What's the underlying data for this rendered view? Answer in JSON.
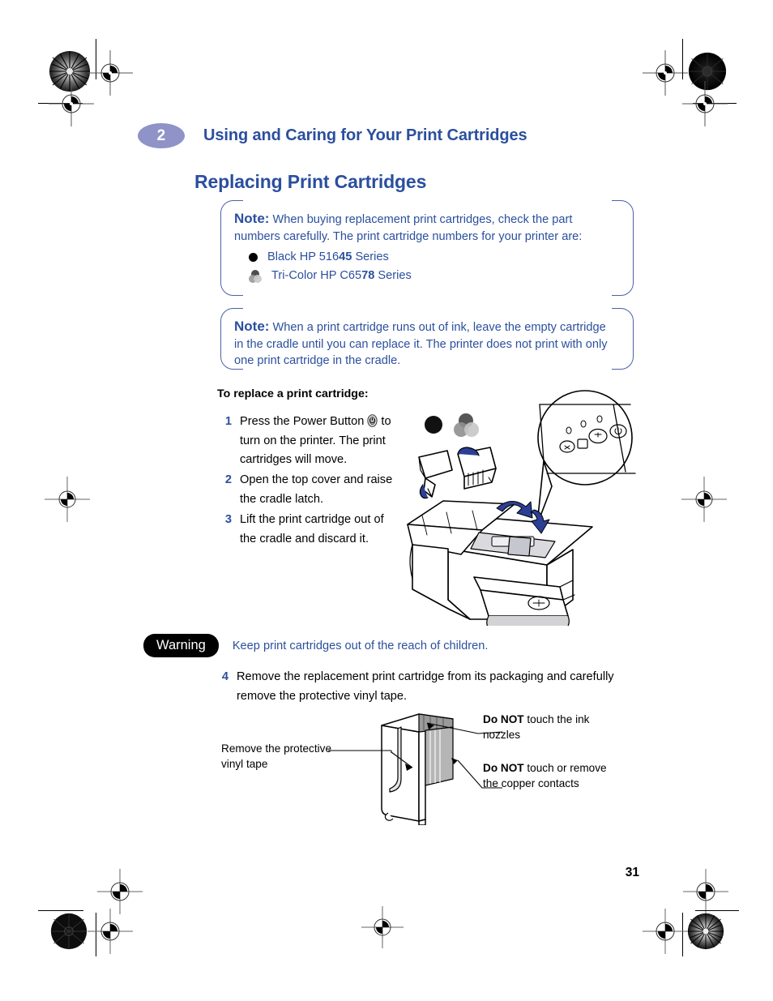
{
  "page": {
    "number": "31",
    "background": "#ffffff",
    "accent_blue": "#2b4f9e",
    "badge_purple": "#8f93c8"
  },
  "header": {
    "chapter_number": "2",
    "chapter_title": "Using and Caring for Your Print Cartridges",
    "section_title": "Replacing Print Cartridges"
  },
  "notes": [
    {
      "lead": "Note:",
      "text": "When buying replacement print cartridges, check the part numbers carefully. The print cartridge numbers for your printer are:",
      "cartridges": [
        {
          "icon": "black-dot-icon",
          "prefix": "Black HP 516",
          "bold": "45",
          "suffix": " Series"
        },
        {
          "icon": "tri-color-dots-icon",
          "prefix": "Tri-Color HP C65",
          "bold": "78",
          "suffix": " Series"
        }
      ]
    },
    {
      "lead": "Note:",
      "text": "When a print cartridge runs out of ink, leave the empty cartridge in the cradle until you can replace it. The printer does not print with only one print cartridge in the cradle."
    }
  ],
  "procedure": {
    "heading": "To replace a print cartridge:",
    "steps": [
      {
        "num": "1",
        "text_before": "Press the Power Button ",
        "icon": "power-button-icon",
        "text_after": " to turn on the printer. The print cartridges will move."
      },
      {
        "num": "2",
        "text_before": "Open the top cover and raise the cradle latch.",
        "icon": "",
        "text_after": ""
      },
      {
        "num": "3",
        "text_before": "Lift the print cartridge out of the cradle and discard it.",
        "icon": "",
        "text_after": ""
      },
      {
        "num": "4",
        "text_before": "Remove the replacement print cartridge from its packaging and carefully remove the protective vinyl tape.",
        "icon": "",
        "text_after": ""
      }
    ]
  },
  "warning": {
    "badge_label": "Warning",
    "text": "Keep print cartridges out of the reach of children."
  },
  "callouts": {
    "left": "Remove the protective vinyl tape",
    "top_right_bold": "Do NOT",
    "top_right_rest": " touch the ink nozzles",
    "bottom_right_bold": "Do NOT",
    "bottom_right_rest": " touch or remove the copper contacts"
  },
  "illustrations": {
    "printer_diagram": "printer-with-open-cover-and-control-panel-magnifier",
    "cartridge_diagram": "print-cartridge-with-vinyl-tape-nozzles-and-contacts"
  },
  "print_marks": {
    "registration_icon": "registration-crosshair-icon",
    "density_icon": "star-density-target-icon",
    "trim_icon": "trim-line-icon"
  }
}
